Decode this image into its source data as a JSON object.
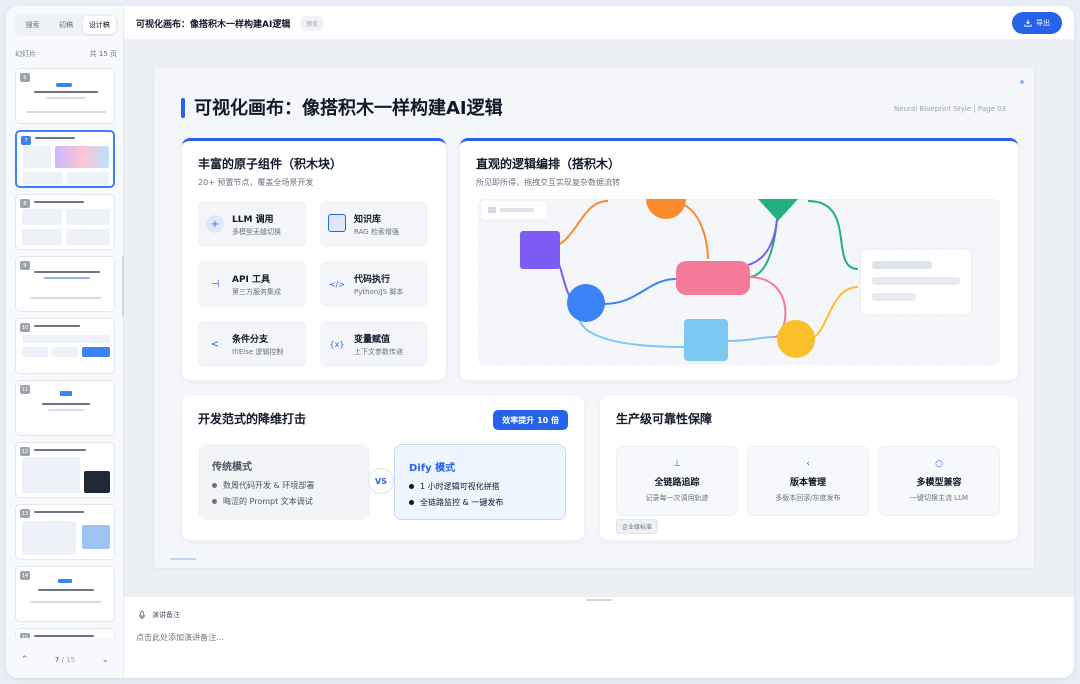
{
  "sidebar": {
    "tabs": [
      "搜索",
      "初稿",
      "设计稿"
    ],
    "active_tab": "设计稿",
    "section_label": "幻灯片",
    "total_label": "共 15 页",
    "thumbnails": [
      "6",
      "7",
      "8",
      "9",
      "10",
      "11",
      "12",
      "13",
      "14",
      "15"
    ],
    "active_thumbnail": "7",
    "pager": {
      "current": "7",
      "sep": "/",
      "total": "15"
    }
  },
  "topbar": {
    "title": "可视化画布：像搭积木一样构建AI逻辑",
    "badge": "预览",
    "export_label": "导出"
  },
  "slide": {
    "title": "可视化画布：像搭积木一样构建AI逻辑",
    "subtitle": "Neural Blueprint Style | Page 03",
    "components_card": {
      "heading": "丰富的原子组件（积木块）",
      "subheading": "20+ 预置节点，覆盖全场景开发",
      "items": [
        {
          "icon": "plus-icon",
          "glyph": "+",
          "title": "LLM 调用",
          "desc": "多模型无缝切换"
        },
        {
          "icon": "database-icon",
          "glyph": "▢",
          "title": "知识库",
          "desc": "RAG 检索增强"
        },
        {
          "icon": "plug-icon",
          "glyph": "⊣",
          "title": "API 工具",
          "desc": "第三方服务集成"
        },
        {
          "icon": "code-icon",
          "glyph": "</>",
          "title": "代码执行",
          "desc": "Python/JS 脚本"
        },
        {
          "icon": "branch-icon",
          "glyph": "<",
          "title": "条件分支",
          "desc": "If/Else 逻辑控制"
        },
        {
          "icon": "variable-icon",
          "glyph": "{x}",
          "title": "变量赋值",
          "desc": "上下文参数传递"
        }
      ]
    },
    "orchestration_card": {
      "heading": "直观的逻辑编排（搭积木）",
      "subheading": "所见即所得，拖拽交互实现复杂数据流转"
    },
    "paradigm_card": {
      "heading": "开发范式的降维打击",
      "boost_badge": "效率提升 10 倍",
      "traditional": {
        "title": "传统模式",
        "bullets": [
          "数周代码开发 & 环境部署",
          "晦涩的 Prompt 文本调试"
        ]
      },
      "vs_label": "VS",
      "dify": {
        "title": "Dify 模式",
        "bullets": [
          "1 小时逻辑可视化拼搭",
          "全链路监控 & 一键发布"
        ]
      }
    },
    "reliability_card": {
      "heading": "生产级可靠性保障",
      "items": [
        {
          "icon": "trace-icon",
          "glyph": "⊥",
          "title": "全链路追踪",
          "desc": "记录每一次调用轨迹"
        },
        {
          "icon": "version-icon",
          "glyph": "‹",
          "title": "版本管理",
          "desc": "多版本回滚/灰度发布"
        },
        {
          "icon": "model-icon",
          "glyph": "○",
          "title": "多模型兼容",
          "desc": "一键切换主流 LLM"
        }
      ],
      "tag": "企业级标准"
    }
  },
  "notes": {
    "label": "演讲备注",
    "placeholder": "点击此处添加演讲备注..."
  },
  "colors": {
    "accent": "#2563eb",
    "node_purple": "#7c5cf5",
    "node_blue": "#3b82f6",
    "node_pink": "#f47a9a",
    "node_cyan": "#7cc8f2",
    "node_yellow": "#f9c02b",
    "node_orange": "#fb8a2c",
    "node_green": "#22b07d"
  }
}
